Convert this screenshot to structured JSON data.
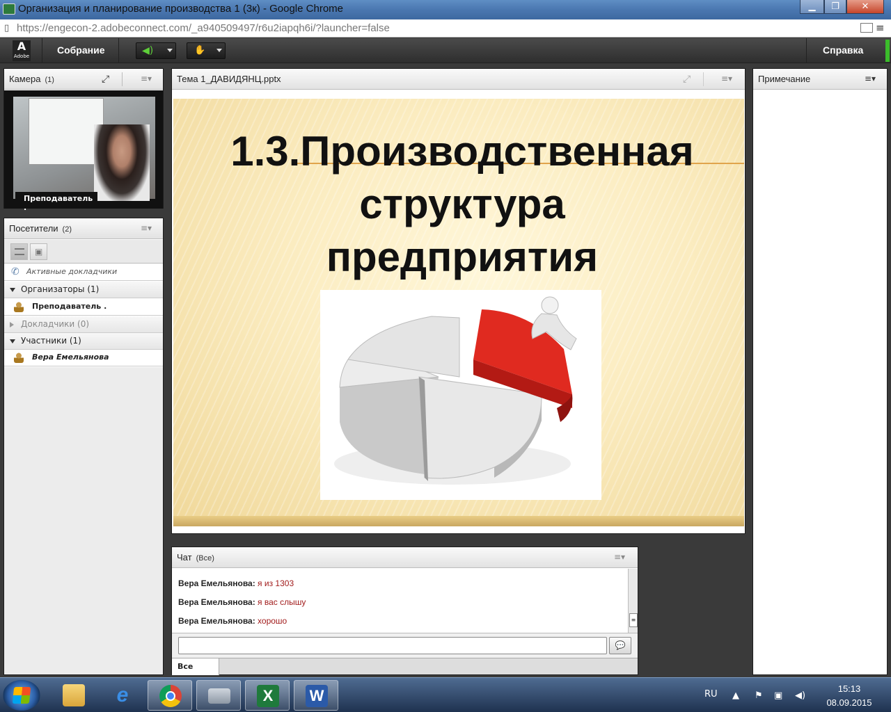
{
  "window": {
    "title": "Организация и планирование производства 1 (3к) - Google Chrome",
    "min_glyph": "▁",
    "max_glyph": "❐",
    "close_glyph": "✕"
  },
  "address": {
    "url": "https://engecon-2.adobeconnect.com/_a940509497/r6u2iapqh6i/?launcher=false"
  },
  "toolbar": {
    "logo_mark": "A",
    "logo_text": "Adobe",
    "meeting_menu": "Собрание",
    "help_menu": "Справка"
  },
  "camera_pod": {
    "title": "Камера",
    "count": "(1)",
    "presenter_label": "Преподаватель ."
  },
  "attendees_pod": {
    "title": "Посетители",
    "count": "(2)",
    "active_speakers": "Активные докладчики",
    "groups": [
      {
        "label": "Организаторы (1)",
        "member": "Преподаватель ."
      },
      {
        "label": "Докладчики (0)"
      },
      {
        "label": "Участники (1)",
        "member": "Вера Емельянова"
      }
    ]
  },
  "share_pod": {
    "title": "Тема 1_ДАВИДЯНЦ.pptx",
    "slide_title_line1": "1.3.Производственная",
    "slide_title_line2": "структура",
    "slide_title_line3": "предприятия"
  },
  "note_pod": {
    "title": "Примечание"
  },
  "chat_pod": {
    "title": "Чат",
    "scope": "(Все)",
    "messages": [
      {
        "author": "Вера Емельянова:",
        "text": "я из 1303"
      },
      {
        "author": "Вера Емельянова:",
        "text": "я вас слышу"
      },
      {
        "author": "Вера Емельянова:",
        "text": "хорошо"
      }
    ],
    "input_value": "",
    "tab_all": "Все"
  },
  "taskbar": {
    "language": "RU",
    "time": "15:13",
    "date": "08.09.2015"
  },
  "colors": {
    "slide_rule": "#e0a44c",
    "chart_red": "#e02a20",
    "chat_text": "#a11b1b",
    "speaker_green": "#5fd03a"
  }
}
